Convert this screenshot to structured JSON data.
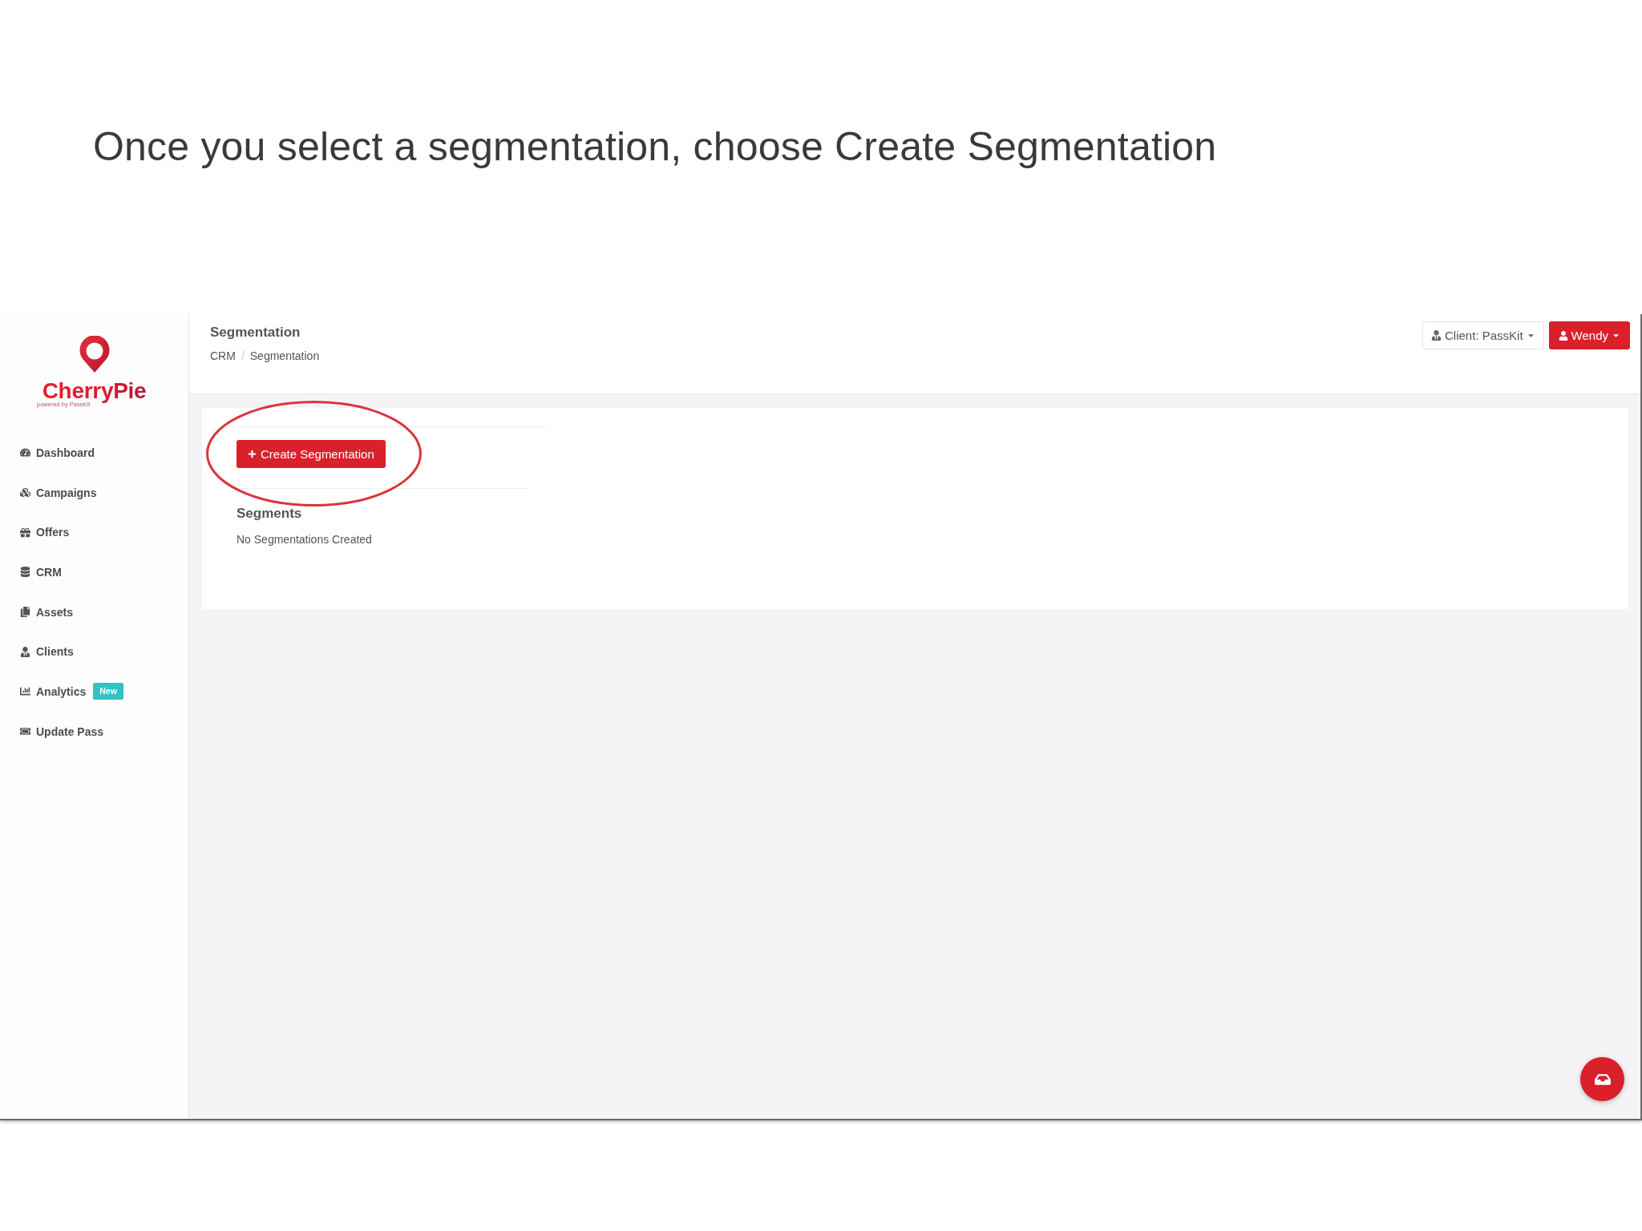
{
  "slide_title": "Once you select a segmentation, choose Create Segmentation",
  "sidebar": {
    "logo": {
      "name": "CherryPie",
      "tagline": "powered by PassKit"
    },
    "items": [
      {
        "label": "Dashboard",
        "selected": false
      },
      {
        "label": "Campaigns",
        "selected": false
      },
      {
        "label": "Offers",
        "selected": false
      },
      {
        "label": "CRM",
        "selected": false
      },
      {
        "label": "Assets",
        "selected": false
      },
      {
        "label": "Clients",
        "selected": false
      },
      {
        "label": "Analytics",
        "selected": false,
        "badge": "New"
      },
      {
        "label": "Update Pass",
        "selected": false
      }
    ]
  },
  "header": {
    "title": "Segmentation",
    "breadcrumb": {
      "items": [
        "CRM",
        "Segmentation"
      ],
      "separator": "/"
    },
    "client_button": {
      "label": "Client: PassKit"
    },
    "user_button": {
      "label": "Wendy"
    }
  },
  "content": {
    "create_button": {
      "label": "Create Segmentation",
      "highlighted": true
    },
    "segments": {
      "title": "Segments",
      "empty_message": "No Segmentations Created"
    }
  }
}
